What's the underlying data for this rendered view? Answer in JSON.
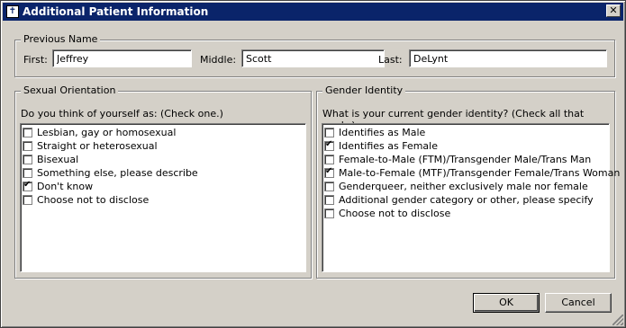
{
  "window": {
    "title": "Additional Patient Information",
    "close_glyph": "✕"
  },
  "previous_name": {
    "group_title": "Previous Name",
    "first_label": "First:",
    "first_value": "Jeffrey",
    "middle_label": "Middle:",
    "middle_value": "Scott",
    "last_label": "Last:",
    "last_value": "DeLynt"
  },
  "sexual_orientation": {
    "group_title": "Sexual Orientation",
    "question": "Do you think of yourself as:  (Check one.)",
    "options": [
      {
        "label": "Lesbian, gay or homosexual",
        "checked": false
      },
      {
        "label": "Straight or heterosexual",
        "checked": false
      },
      {
        "label": "Bisexual",
        "checked": false
      },
      {
        "label": "Something else, please describe",
        "checked": false
      },
      {
        "label": "Don't know",
        "checked": true
      },
      {
        "label": "Choose not to disclose",
        "checked": false
      }
    ]
  },
  "gender_identity": {
    "group_title": "Gender Identity",
    "question": "What is your current gender identity?  (Check all that apply.)",
    "options": [
      {
        "label": "Identifies as Male",
        "checked": false
      },
      {
        "label": "Identifies as Female",
        "checked": true
      },
      {
        "label": "Female-to-Male (FTM)/Transgender Male/Trans Man",
        "checked": false
      },
      {
        "label": "Male-to-Female (MTF)/Transgender Female/Trans Woman",
        "checked": true
      },
      {
        "label": "Genderqueer, neither exclusively male nor female",
        "checked": false
      },
      {
        "label": "Additional gender category or other, please specify",
        "checked": false
      },
      {
        "label": "Choose not to disclose",
        "checked": false
      }
    ]
  },
  "buttons": {
    "ok": "OK",
    "cancel": "Cancel"
  },
  "icons": {
    "app": "caduceus-icon",
    "close": "close-icon",
    "resize": "resize-grip-icon"
  }
}
